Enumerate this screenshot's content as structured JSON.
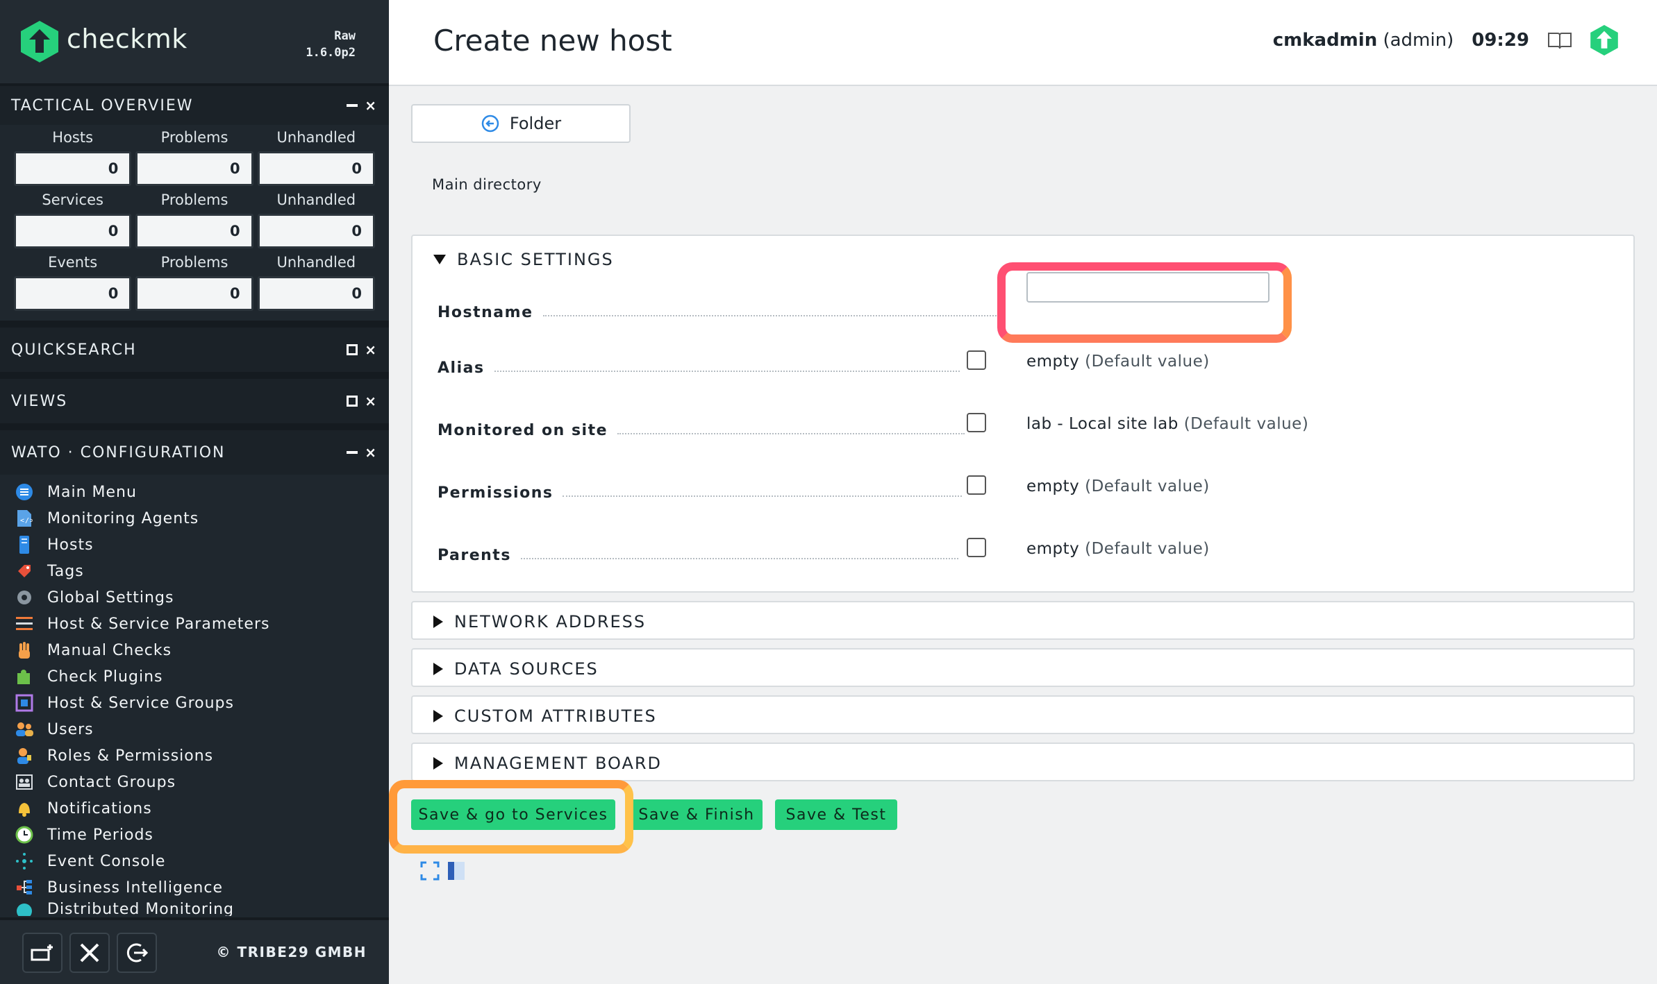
{
  "app": {
    "logo_text": "checkmk",
    "edition": "Raw",
    "version": "1.6.0p2",
    "brand_color": "#26d07c",
    "sidebar_bg": "#1f272e"
  },
  "tactical": {
    "title": "TACTICAL OVERVIEW",
    "rows": [
      {
        "labels": [
          "Hosts",
          "Problems",
          "Unhandled"
        ],
        "values": [
          "0",
          "0",
          "0"
        ]
      },
      {
        "labels": [
          "Services",
          "Problems",
          "Unhandled"
        ],
        "values": [
          "0",
          "0",
          "0"
        ]
      },
      {
        "labels": [
          "Events",
          "Problems",
          "Unhandled"
        ],
        "values": [
          "0",
          "0",
          "0"
        ]
      }
    ]
  },
  "quicksearch": {
    "title": "QUICKSEARCH"
  },
  "views": {
    "title": "VIEWS"
  },
  "wato": {
    "title": "WATO · CONFIGURATION",
    "items": [
      {
        "label": "Main Menu",
        "icon": "main-menu-icon"
      },
      {
        "label": "Monitoring Agents",
        "icon": "agents-icon"
      },
      {
        "label": "Hosts",
        "icon": "hosts-icon"
      },
      {
        "label": "Tags",
        "icon": "tags-icon"
      },
      {
        "label": "Global Settings",
        "icon": "gear-icon"
      },
      {
        "label": "Host & Service Parameters",
        "icon": "rulesets-icon"
      },
      {
        "label": "Manual Checks",
        "icon": "hand-icon"
      },
      {
        "label": "Check Plugins",
        "icon": "puzzle-icon"
      },
      {
        "label": "Host & Service Groups",
        "icon": "groups-icon"
      },
      {
        "label": "Users",
        "icon": "users-icon"
      },
      {
        "label": "Roles & Permissions",
        "icon": "roles-icon"
      },
      {
        "label": "Contact Groups",
        "icon": "contact-groups-icon"
      },
      {
        "label": "Notifications",
        "icon": "bell-icon"
      },
      {
        "label": "Time Periods",
        "icon": "clock-icon"
      },
      {
        "label": "Event Console",
        "icon": "event-console-icon"
      },
      {
        "label": "Business Intelligence",
        "icon": "bi-icon"
      },
      {
        "label": "Distributed Monitoring",
        "icon": "distributed-icon"
      }
    ]
  },
  "footer": {
    "copyright": "© TRIBE29 GMBH"
  },
  "header": {
    "title": "Create new host",
    "user": "cmkadmin",
    "role": "(admin)",
    "time": "09:29"
  },
  "folder_button": {
    "label": "Folder"
  },
  "breadcrumb": "Main directory",
  "basic_settings": {
    "title": "BASIC SETTINGS",
    "hostname": {
      "label": "Hostname",
      "value": ""
    },
    "fields": [
      {
        "label": "Alias",
        "value": "empty",
        "default": "(Default value)"
      },
      {
        "label": "Monitored on site",
        "value": "lab - Local site lab",
        "default": "(Default value)"
      },
      {
        "label": "Permissions",
        "value": "empty",
        "default": "(Default value)"
      },
      {
        "label": "Parents",
        "value": "empty",
        "default": "(Default value)"
      }
    ]
  },
  "sections": [
    "NETWORK ADDRESS",
    "DATA SOURCES",
    "CUSTOM ATTRIBUTES",
    "MANAGEMENT BOARD"
  ],
  "buttons": {
    "save_services": "Save & go to Services",
    "save_finish": "Save & Finish",
    "save_test": "Save & Test"
  }
}
